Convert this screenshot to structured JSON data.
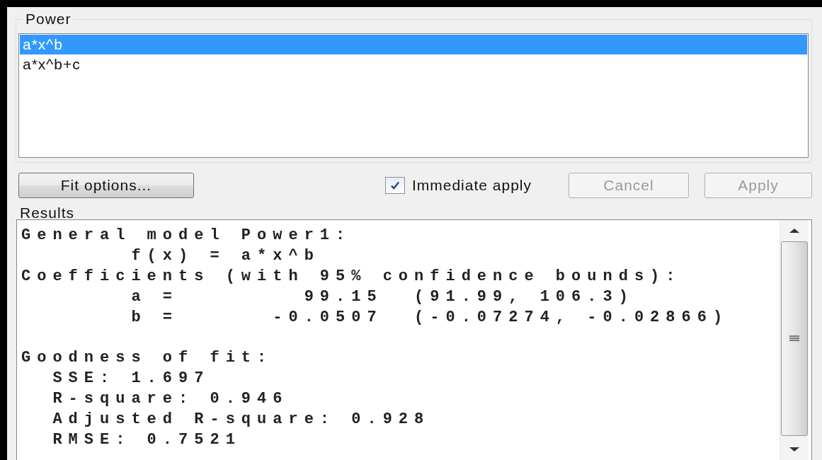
{
  "group": {
    "title": "Power",
    "items": [
      {
        "label": "a*x^b",
        "selected": true
      },
      {
        "label": "a*x^b+c",
        "selected": false
      }
    ]
  },
  "toolbar": {
    "fit_options": "Fit options...",
    "immediate_apply": {
      "label": "Immediate apply",
      "checked": true
    },
    "buttons": [
      {
        "label": "Cancel",
        "disabled": true
      },
      {
        "label": "Apply",
        "disabled": true
      }
    ]
  },
  "results": {
    "title": "Results",
    "sections": [
      {
        "lines": [
          "General model Power1:",
          "       f(x) = a*x^b",
          "Coefficients (with 95% confidence bounds):",
          "       a =        99.15  (91.99, 106.3)",
          "       b =      -0.0507  (-0.07274, -0.02866)"
        ]
      },
      {
        "lines": [
          "Goodness of fit:",
          "  SSE: 1.697",
          "  R-square: 0.946",
          "  Adjusted R-square: 0.928",
          "  RMSE: 0.7521"
        ]
      }
    ]
  }
}
